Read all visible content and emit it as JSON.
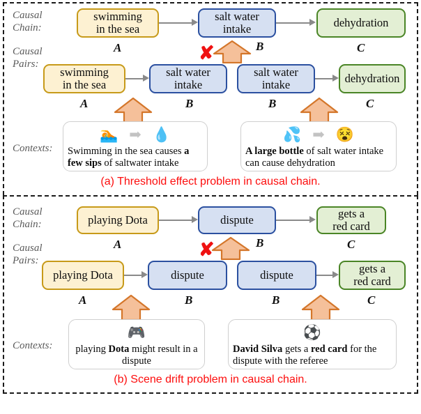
{
  "figure": {
    "row_labels": {
      "causal_chain": "Causal\nChain:",
      "causal_pairs": "Causal\nPairs:",
      "contexts": "Contexts:"
    },
    "node_letters": {
      "a": "A",
      "b": "B",
      "c": "C"
    },
    "reject_mark": "✘"
  },
  "panel_a": {
    "caption": "(a) Threshold effect problem in causal chain.",
    "chain": [
      {
        "text": "swimming\nin the sea",
        "color": "yellow",
        "letter": "A"
      },
      {
        "text": "salt water\nintake",
        "color": "blue",
        "letter": "B"
      },
      {
        "text": "dehydration",
        "color": "green",
        "letter": "C"
      }
    ],
    "pairs": [
      {
        "left": {
          "text": "swimming\nin the sea",
          "color": "yellow",
          "letter": "A"
        },
        "right": {
          "text": "salt water\nintake",
          "color": "blue",
          "letter": "B"
        }
      },
      {
        "left": {
          "text": "salt water\nintake",
          "color": "blue",
          "letter": "B"
        },
        "right": {
          "text": "dehydration",
          "color": "green",
          "letter": "C"
        }
      }
    ],
    "contexts": [
      {
        "emoji_left": "🏊",
        "emoji_arrow": "➡",
        "emoji_right": "💧",
        "text_html": "Swimming in the sea causes <b>a few sips</b> of saltwater intake",
        "text_plain": "Swimming in the sea causes a few sips of saltwater intake"
      },
      {
        "emoji_left": "💦",
        "emoji_arrow": "➡",
        "emoji_right": "😵",
        "text_html": "<b>A large bottle</b> of salt water intake can cause dehydration",
        "text_plain": "A large bottle of salt water intake can cause dehydration"
      }
    ]
  },
  "panel_b": {
    "caption": "(b) Scene drift problem in causal chain.",
    "chain": [
      {
        "text": "playing Dota",
        "color": "yellow",
        "letter": "A"
      },
      {
        "text": "dispute",
        "color": "blue",
        "letter": "B"
      },
      {
        "text": "gets a\nred card",
        "color": "green",
        "letter": "C"
      }
    ],
    "pairs": [
      {
        "left": {
          "text": "playing Dota",
          "color": "yellow",
          "letter": "A"
        },
        "right": {
          "text": "dispute",
          "color": "blue",
          "letter": "B"
        }
      },
      {
        "left": {
          "text": "dispute",
          "color": "blue",
          "letter": "B"
        },
        "right": {
          "text": "gets a\nred card",
          "color": "green",
          "letter": "C"
        }
      }
    ],
    "contexts": [
      {
        "emoji_left": "🎮",
        "emoji_arrow": "",
        "emoji_right": "",
        "text_html": "playing <b>Dota</b> might result in a dispute",
        "text_plain": "playing Dota might result in a dispute"
      },
      {
        "emoji_left": "⚽",
        "emoji_arrow": "",
        "emoji_right": "",
        "text_html": "<b>David Silva</b> gets a <b>red card</b> for the dispute with the referee",
        "text_plain": "David Silva gets a red card for the dispute with the referee"
      }
    ]
  },
  "colors": {
    "yellow_fill": "#fdf1d2",
    "yellow_border": "#c79a19",
    "blue_fill": "#d6e0f2",
    "blue_border": "#2b50a0",
    "green_fill": "#e3efd4",
    "green_border": "#4a8526",
    "arrow_fill": "#f5c09a",
    "arrow_border": "#d4762a",
    "reject_red": "#ef1111",
    "caption_red": "#fd0d0d",
    "connector_gray": "#8a8a8a"
  }
}
